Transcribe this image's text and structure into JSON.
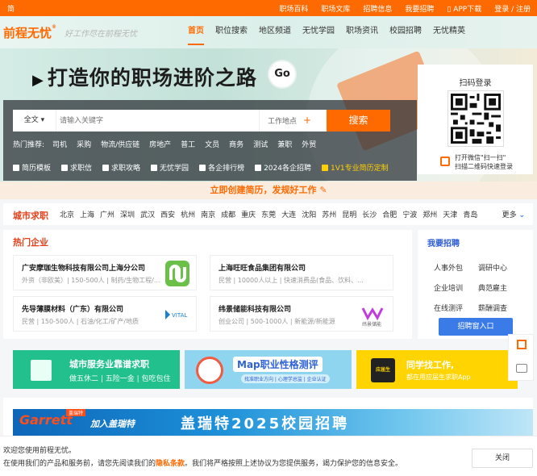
{
  "topbar": {
    "left": "简",
    "links": [
      "职场百科",
      "职场文库",
      "招聘信息",
      "我要招聘",
      "APP下载",
      "登录 / 注册"
    ]
  },
  "header": {
    "logo": "前程无忧",
    "slogan": "好工作尽在前程无忧",
    "nav": [
      "首页",
      "职位搜索",
      "地区频道",
      "无忧学园",
      "职场资讯",
      "校园招聘",
      "无忧精英"
    ]
  },
  "hero": {
    "title": "打造你的职场进阶之路",
    "go": "Go"
  },
  "search": {
    "scope": "全文",
    "placeholder": "请输入关键字",
    "location": "工作地点",
    "button": "搜索",
    "hot_label": "热门推荐:",
    "hot": [
      "司机",
      "采购",
      "物流/供应链",
      "房地产",
      "普工",
      "文员",
      "商务",
      "测试",
      "兼职",
      "外贸"
    ],
    "tools": [
      "简历模板",
      "求职信",
      "求职攻略",
      "无忧学园",
      "各企排行榜",
      "2024各企招聘",
      "1V1专业简历定制"
    ]
  },
  "qr": {
    "title": "扫码登录",
    "tip1": "打开微信\"扫一扫\"",
    "tip2": "扫描二维码快速登录"
  },
  "resume_bar": "立即创建简历，发规好工作",
  "city": {
    "title": "城市求职",
    "cities": [
      "北京",
      "上海",
      "广州",
      "深圳",
      "武汉",
      "西安",
      "杭州",
      "南京",
      "成都",
      "重庆",
      "东莞",
      "大连",
      "沈阳",
      "苏州",
      "昆明",
      "长沙",
      "合肥",
      "宁波",
      "郑州",
      "天津",
      "青岛"
    ],
    "more": "更多"
  },
  "hot_companies": {
    "title": "热门企业",
    "items": [
      {
        "name": "广安摩珈生物科技有限公司上海分公司",
        "meta": "外资（非欧美）| 150-500人 | 制药/生物工程/..."
      },
      {
        "name": "上海旺旺食品集团有限公司",
        "meta": "民营 | 10000人以上 | 快速消费品(食品、饮料、..."
      },
      {
        "name": "先导薄膜材料（广东）有限公司",
        "meta": "民营 | 150-500人 | 石油/化工/矿产/地质"
      },
      {
        "name": "纬景储能科技有限公司",
        "meta": "创业公司 | 500-1000人 | 新能源/新能源"
      }
    ],
    "logo_texts": [
      "VITAL",
      "纬景储能"
    ]
  },
  "recruit": {
    "title": "我要招聘",
    "items": [
      "人事外包",
      "调研中心",
      "企业培训",
      "典范雇主",
      "在线测评",
      "薪酬调查"
    ],
    "button": "招聘窗入口"
  },
  "banners": {
    "b1_title": "城市服务业靠谱求职",
    "b1_sub": "做五休二 | 五险一金 | 包吃包住",
    "b2_title": "Map职业性格测评",
    "b2_sub": "找准职业方向 | 心理学总监 | 企业认证",
    "b3_box": "应届生",
    "b3_title": "同学找工作,",
    "b3_sub": "都在用应届生求职App"
  },
  "big_banner": {
    "brand": "Garrett",
    "tag": "盖瑞特",
    "join": "加入盖瑞特",
    "campaign": "盖瑞特2025校园招聘"
  },
  "cookie": {
    "line1": "欢迎您使用前程无忧。",
    "line2_pre": "在使用我们的产品和服务前，请您先阅读我们的",
    "link": "隐私条款",
    "line2_post": "。我们将严格按照上述协议为您提供服务，竭力保护您的信息安全。",
    "close": "关闭"
  },
  "colors": {
    "brand": "#ff6a00",
    "blue": "#3b7be8",
    "red": "#e6401a"
  }
}
